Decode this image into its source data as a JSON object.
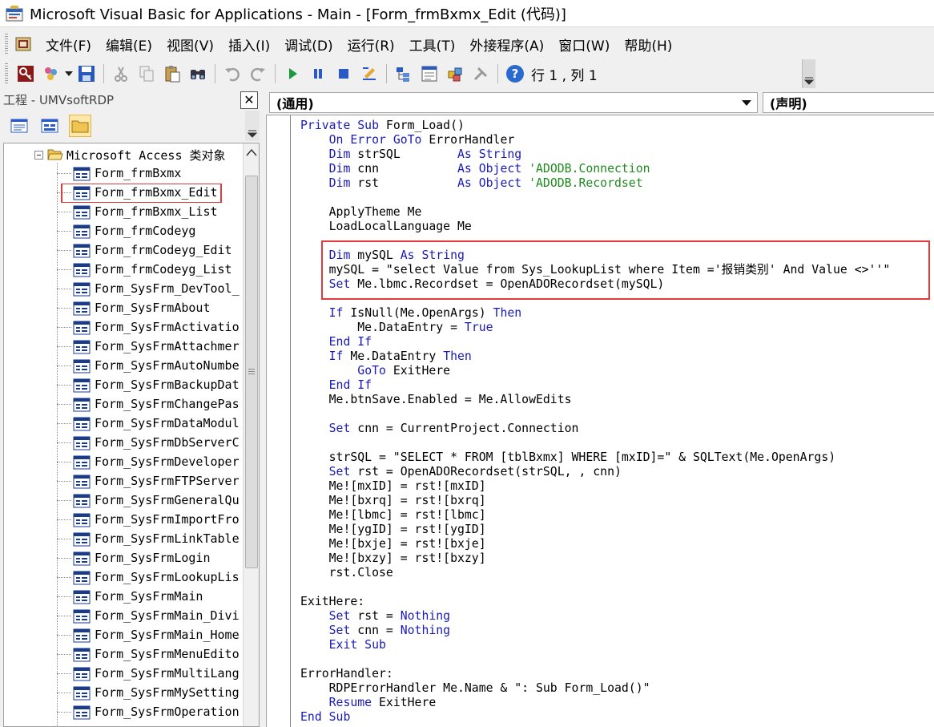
{
  "window": {
    "title": "Microsoft Visual Basic for Applications - Main - [Form_frmBxmx_Edit (代码)]"
  },
  "menu": {
    "items": [
      "文件(F)",
      "编辑(E)",
      "视图(V)",
      "插入(I)",
      "调试(D)",
      "运行(R)",
      "工具(T)",
      "外接程序(A)",
      "窗口(W)",
      "帮助(H)"
    ]
  },
  "toolbar": {
    "position": "行 1 , 列 1"
  },
  "project": {
    "title": "工程 - UMVsoftRDP",
    "close_glyph": "✕",
    "root_label": "Microsoft Access 类对象",
    "selected_item": "Form_frmBxmx_Edit",
    "items": [
      "Form_frmBxmx",
      "Form_frmBxmx_Edit",
      "Form_frmBxmx_List",
      "Form_frmCodeyg",
      "Form_frmCodeyg_Edit",
      "Form_frmCodeyg_List",
      "Form_SysFrm_DevTool_",
      "Form_SysFrmAbout",
      "Form_SysFrmActivatio",
      "Form_SysFrmAttachmer",
      "Form_SysFrmAutoNumbe",
      "Form_SysFrmBackupDat",
      "Form_SysFrmChangePas",
      "Form_SysFrmDataModul",
      "Form_SysFrmDbServerC",
      "Form_SysFrmDeveloper",
      "Form_SysFrmFTPServer",
      "Form_SysFrmGeneralQu",
      "Form_SysFrmImportFro",
      "Form_SysFrmLinkTable",
      "Form_SysFrmLogin",
      "Form_SysFrmLookupLis",
      "Form_SysFrmMain",
      "Form_SysFrmMain_Divi",
      "Form_SysFrmMain_Home",
      "Form_SysFrmMenuEdito",
      "Form_SysFrmMultiLang",
      "Form_SysFrmMySetting",
      "Form_SysFrmOperation"
    ]
  },
  "code": {
    "object_combo": "(通用)",
    "procedure_combo": "(声明)",
    "lines": [
      [
        [
          "kw",
          "Private Sub "
        ],
        [
          "",
          "Form_Load()"
        ]
      ],
      [
        [
          "",
          "    "
        ],
        [
          "kw",
          "On Error GoTo "
        ],
        [
          "",
          "ErrorHandler"
        ]
      ],
      [
        [
          "",
          "    "
        ],
        [
          "kw",
          "Dim "
        ],
        [
          "",
          "strSQL        "
        ],
        [
          "kw",
          "As String"
        ]
      ],
      [
        [
          "",
          "    "
        ],
        [
          "kw",
          "Dim "
        ],
        [
          "",
          "cnn           "
        ],
        [
          "kw",
          "As Object "
        ],
        [
          "cm",
          "'ADODB.Connection"
        ]
      ],
      [
        [
          "",
          "    "
        ],
        [
          "kw",
          "Dim "
        ],
        [
          "",
          "rst           "
        ],
        [
          "kw",
          "As Object "
        ],
        [
          "cm",
          "'ADODB.Recordset"
        ]
      ],
      [
        [
          "",
          ""
        ]
      ],
      [
        [
          "",
          "    ApplyTheme Me"
        ]
      ],
      [
        [
          "",
          "    LoadLocalLanguage Me"
        ]
      ],
      [
        [
          "",
          ""
        ]
      ],
      [
        [
          "",
          "    "
        ],
        [
          "kw",
          "Dim "
        ],
        [
          "",
          "mySQL "
        ],
        [
          "kw",
          "As String"
        ]
      ],
      [
        [
          "",
          "    mySQL = \"select Value from Sys_LookupList where Item ='报销类别' And Value <>''\""
        ]
      ],
      [
        [
          "",
          "    "
        ],
        [
          "kw",
          "Set "
        ],
        [
          "",
          "Me.lbmc.Recordset = OpenADORecordset(mySQL)"
        ]
      ],
      [
        [
          "",
          ""
        ]
      ],
      [
        [
          "",
          "    "
        ],
        [
          "kw",
          "If "
        ],
        [
          "",
          "IsNull(Me.OpenArgs) "
        ],
        [
          "kw",
          "Then"
        ]
      ],
      [
        [
          "",
          "        Me.DataEntry = "
        ],
        [
          "kw",
          "True"
        ]
      ],
      [
        [
          "",
          "    "
        ],
        [
          "kw",
          "End If"
        ]
      ],
      [
        [
          "",
          "    "
        ],
        [
          "kw",
          "If "
        ],
        [
          "",
          "Me.DataEntry "
        ],
        [
          "kw",
          "Then"
        ]
      ],
      [
        [
          "",
          "        "
        ],
        [
          "kw",
          "GoTo "
        ],
        [
          "",
          "ExitHere"
        ]
      ],
      [
        [
          "",
          "    "
        ],
        [
          "kw",
          "End If"
        ]
      ],
      [
        [
          "",
          "    Me.btnSave.Enabled = Me.AllowEdits"
        ]
      ],
      [
        [
          "",
          ""
        ]
      ],
      [
        [
          "",
          "    "
        ],
        [
          "kw",
          "Set "
        ],
        [
          "",
          "cnn = CurrentProject.Connection"
        ]
      ],
      [
        [
          "",
          ""
        ]
      ],
      [
        [
          "",
          "    strSQL = \"SELECT * FROM [tblBxmx] WHERE [mxID]=\" & SQLText(Me.OpenArgs)"
        ]
      ],
      [
        [
          "",
          "    "
        ],
        [
          "kw",
          "Set "
        ],
        [
          "",
          "rst = OpenADORecordset(strSQL, , cnn)"
        ]
      ],
      [
        [
          "",
          "    Me![mxID] = rst![mxID]"
        ]
      ],
      [
        [
          "",
          "    Me![bxrq] = rst![bxrq]"
        ]
      ],
      [
        [
          "",
          "    Me![lbmc] = rst![lbmc]"
        ]
      ],
      [
        [
          "",
          "    Me![ygID] = rst![ygID]"
        ]
      ],
      [
        [
          "",
          "    Me![bxje] = rst![bxje]"
        ]
      ],
      [
        [
          "",
          "    Me![bxzy] = rst![bxzy]"
        ]
      ],
      [
        [
          "",
          "    rst.Close"
        ]
      ],
      [
        [
          "",
          ""
        ]
      ],
      [
        [
          "",
          "ExitHere:"
        ]
      ],
      [
        [
          "",
          "    "
        ],
        [
          "kw",
          "Set "
        ],
        [
          "",
          "rst = "
        ],
        [
          "kw",
          "Nothing"
        ]
      ],
      [
        [
          "",
          "    "
        ],
        [
          "kw",
          "Set "
        ],
        [
          "",
          "cnn = "
        ],
        [
          "kw",
          "Nothing"
        ]
      ],
      [
        [
          "",
          "    "
        ],
        [
          "kw",
          "Exit Sub"
        ]
      ],
      [
        [
          "",
          ""
        ]
      ],
      [
        [
          "",
          "ErrorHandler:"
        ]
      ],
      [
        [
          "",
          "    RDPErrorHandler Me.Name & \": Sub Form_Load()\""
        ]
      ],
      [
        [
          "",
          "    "
        ],
        [
          "kw",
          "Resume "
        ],
        [
          "",
          "ExitHere"
        ]
      ],
      [
        [
          "kw",
          "End Sub"
        ]
      ]
    ]
  },
  "colors": {
    "keyword": "#1a1ab8",
    "comment": "#1f8a1f",
    "highlight": "#e23b3b"
  }
}
